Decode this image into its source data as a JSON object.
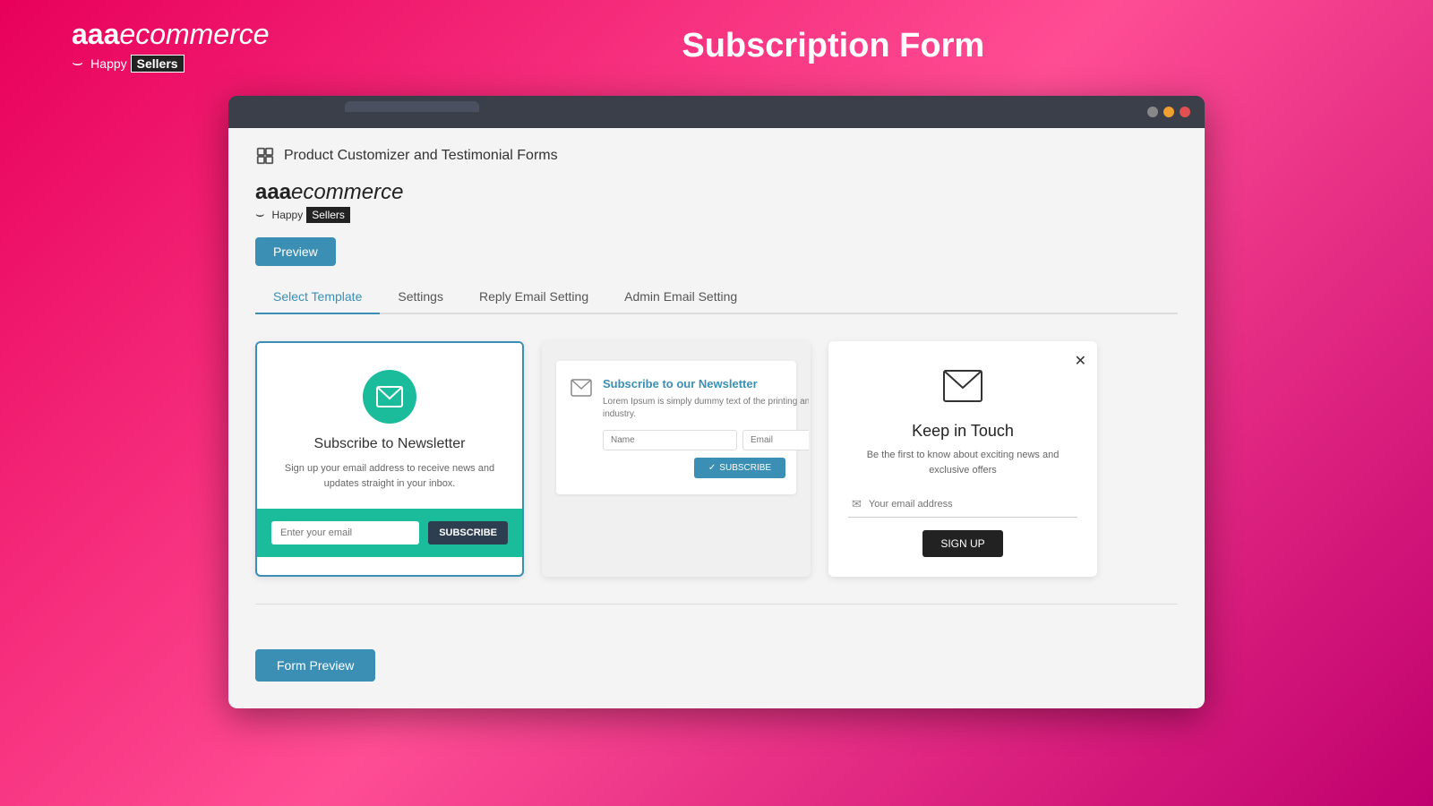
{
  "header": {
    "logo_brand": "aaa",
    "logo_brand_italic": "ecommerce",
    "logo_tagline_happy": "Happy",
    "logo_tagline_sellers": "Sellers",
    "page_title": "Subscription Form"
  },
  "browser": {
    "tab_text": "",
    "dots": [
      "gray",
      "orange",
      "red"
    ]
  },
  "plugin": {
    "title": "Product Customizer and Testimonial Forms",
    "inner_brand": "aaa",
    "inner_brand_italic": "ecommerce",
    "inner_happy": "Happy",
    "inner_sellers": "Sellers"
  },
  "buttons": {
    "preview": "Preview",
    "form_preview": "Form Preview"
  },
  "tabs": [
    {
      "id": "select-template",
      "label": "Select Template",
      "active": true
    },
    {
      "id": "settings",
      "label": "Settings",
      "active": false
    },
    {
      "id": "reply-email",
      "label": "Reply Email Setting",
      "active": false
    },
    {
      "id": "admin-email",
      "label": "Admin Email Setting",
      "active": false
    }
  ],
  "templates": {
    "card1": {
      "title": "Subscribe to Newsletter",
      "description": "Sign up your email address to receive news and updates straight in your inbox.",
      "input_placeholder": "Enter your email",
      "subscribe_btn": "SUBSCRIBE"
    },
    "card2": {
      "title": "Subscribe to our Newsletter",
      "description": "Lorem Ipsum is simply dummy text of the printing and typesetting industry.",
      "name_placeholder": "Name",
      "email_placeholder": "Email",
      "subscribe_btn": "SUBSCRIBE"
    },
    "card3": {
      "title": "Keep in Touch",
      "description": "Be the first to know about exciting news and exclusive offers",
      "input_placeholder": "Your email address",
      "signup_btn": "SIGN UP"
    }
  }
}
